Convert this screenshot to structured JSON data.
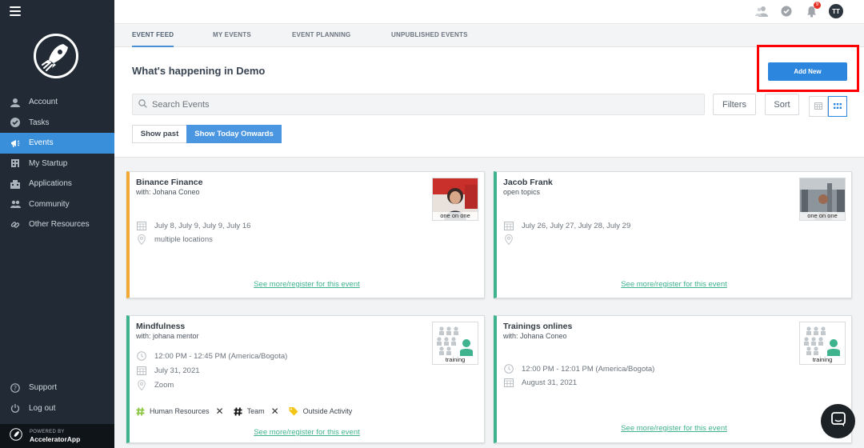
{
  "sidebar": {
    "items": [
      {
        "label": "Account",
        "icon": "user-icon"
      },
      {
        "label": "Tasks",
        "icon": "check-circle-icon"
      },
      {
        "label": "Events",
        "icon": "megaphone-icon"
      },
      {
        "label": "My Startup",
        "icon": "building-icon"
      },
      {
        "label": "Applications",
        "icon": "applications-icon"
      },
      {
        "label": "Community",
        "icon": "community-icon"
      },
      {
        "label": "Other Resources",
        "icon": "link-icon"
      }
    ],
    "active_index": 2,
    "bottom_items": [
      {
        "label": "Support",
        "icon": "help-icon"
      },
      {
        "label": "Log out",
        "icon": "power-icon"
      }
    ],
    "powered_small": "POWERED BY",
    "powered_big": "AcceleratorApp"
  },
  "topbar": {
    "notification_count": "9",
    "avatar_initials": "TT"
  },
  "tabs": [
    {
      "label": "EVENT FEED",
      "active": true
    },
    {
      "label": "MY EVENTS",
      "active": false
    },
    {
      "label": "EVENT PLANNING",
      "active": false
    },
    {
      "label": "UNPUBLISHED EVENTS",
      "active": false
    }
  ],
  "header": {
    "title": "What's happening in Demo",
    "add_new_label": "Add New"
  },
  "search": {
    "placeholder": "Search Events",
    "value": ""
  },
  "controls": {
    "filters_label": "Filters",
    "sort_label": "Sort",
    "show_past_label": "Show past",
    "show_today_label": "Show Today Onwards"
  },
  "cards": [
    {
      "title": "Binance Finance",
      "subtitle": "with: Johana Coneo",
      "dates": "July 8, July 9, July 9, July 16",
      "location": "multiple locations",
      "thumb_label": "one on one",
      "link": "See more/register for this event"
    },
    {
      "title": "Jacob Frank",
      "subtitle": "open topics",
      "dates": "July 26, July 27, July 28, July 29",
      "location": "",
      "thumb_label": "one on one",
      "link": "See more/register for this event"
    },
    {
      "title": "Mindfulness",
      "subtitle": "with: johana mentor",
      "time": "12:00 PM - 12:45 PM (America/Bogota)",
      "date": "July 31, 2021",
      "location": "Zoom",
      "thumb_label": "training",
      "tags": [
        "Human Resources",
        "Team",
        "Outside Activity"
      ],
      "link": "See more/register for this event"
    },
    {
      "title": "Trainings onlines",
      "subtitle": "with: Johana Coneo",
      "time": "12:00 PM - 12:01 PM (America/Bogota)",
      "date": "August 31, 2021",
      "thumb_label": "training",
      "link": "See more/register for this event"
    }
  ],
  "colors": {
    "sidebar_bg": "#222b35",
    "accent_blue": "#2d86de",
    "green_accent": "#3fb28e",
    "orange_accent": "#f2a934",
    "highlight_red": "#ff0000"
  }
}
